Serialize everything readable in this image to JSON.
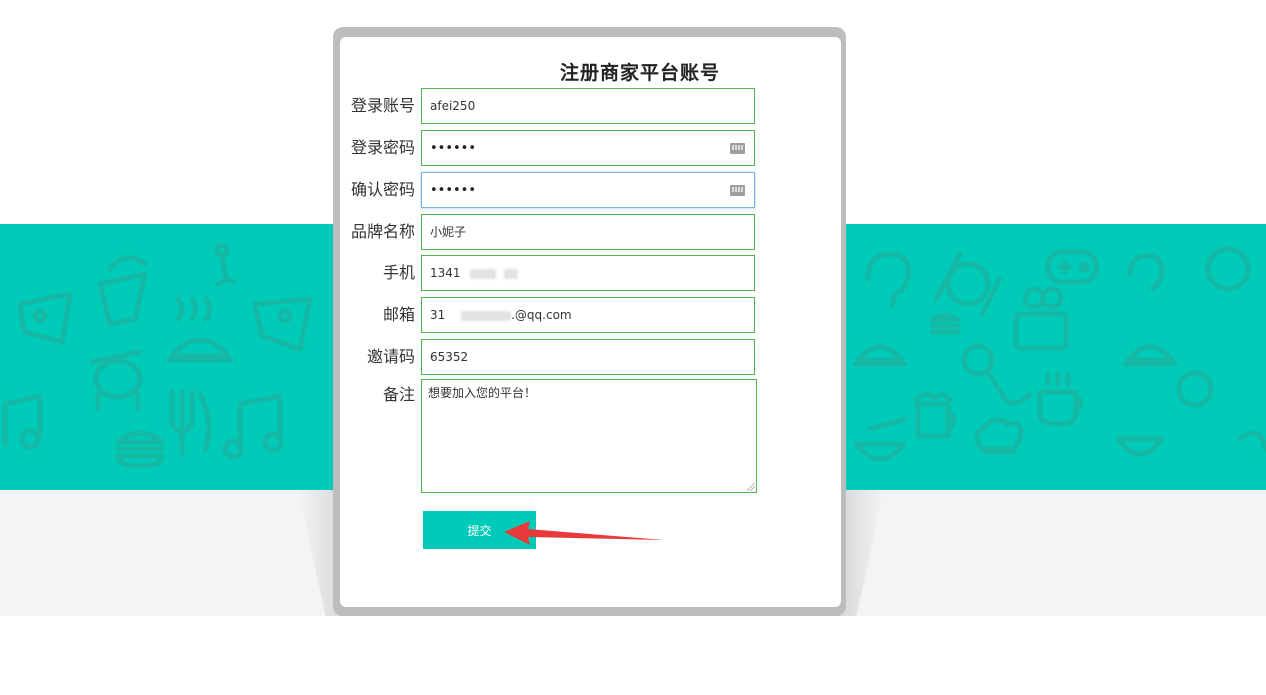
{
  "form": {
    "title": "注册商家平台账号",
    "fields": [
      {
        "label": "登录账号",
        "value": "afei250"
      },
      {
        "label": "登录密码",
        "value": "••••••"
      },
      {
        "label": "确认密码",
        "value": "••••••"
      },
      {
        "label": "品牌名称",
        "value": "小妮子"
      },
      {
        "label": "手机",
        "value": "1341"
      },
      {
        "label": "邮箱",
        "value_prefix": "31",
        "value_suffix": ".@qq.com"
      },
      {
        "label": "邀请码",
        "value": "65352"
      },
      {
        "label": "备注",
        "value": "想要加入您的平台！"
      }
    ],
    "submit_label": "提交"
  },
  "colors": {
    "teal": "#00cbb8",
    "field_border": "#4db84d",
    "arrow": "#e8393b"
  },
  "background_icons": [
    "cupcake-icon",
    "cheese-icon",
    "golf-icon",
    "cloche-icon",
    "drum-icon",
    "cutlery-icon",
    "burger-icon",
    "music-note-icon",
    "plate-icon",
    "gamepad-icon",
    "camera-icon",
    "microphone-icon",
    "beer-icon",
    "chef-hat-icon",
    "coffee-cup-icon",
    "bowl-icon"
  ]
}
